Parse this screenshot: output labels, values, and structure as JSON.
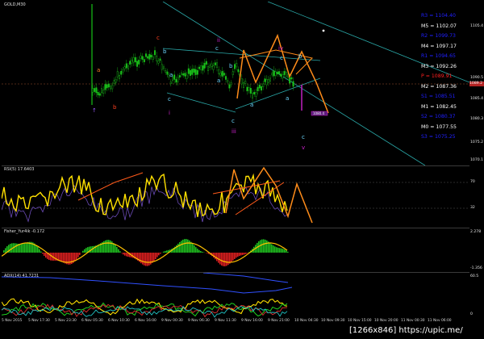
{
  "main_chart": {
    "title": "GOLD,M30",
    "price_axis": [
      "1105.4",
      "1090.5",
      "1085.4",
      "1080.3",
      "1075.2",
      "1070.1"
    ],
    "current_price_label": "1089.2",
    "pivots": [
      {
        "label": "R3 = 1104.40",
        "color": "#2020ff"
      },
      {
        "label": "M5 = 1102.07",
        "color": "#ffffff"
      },
      {
        "label": "R2 = 1099.73",
        "color": "#2020ff"
      },
      {
        "label": "M4 = 1097.17",
        "color": "#ffffff"
      },
      {
        "label": "R1 = 1094.65",
        "color": "#2020ff"
      },
      {
        "label": "M3 = 1092.26",
        "color": "#ffffff"
      },
      {
        "label": "P = 1089.91",
        "color": "#ff2020"
      },
      {
        "label": "M2 = 1087.36",
        "color": "#ffffff"
      },
      {
        "label": "S1 = 1085.51",
        "color": "#2020ff"
      },
      {
        "label": "M1 = 1082.45",
        "color": "#ffffff"
      },
      {
        "label": "S2 = 1080.37",
        "color": "#2020ff"
      },
      {
        "label": "M0 = 1077.55",
        "color": "#ffffff"
      },
      {
        "label": "S3 = 1075.25",
        "color": "#2020ff"
      }
    ],
    "target_box_label": "1080.4",
    "wave_labels": [
      "a",
      "b",
      "c",
      "iii",
      "i",
      "ii",
      "iii",
      "iv",
      "a",
      "b",
      "c",
      "a",
      "b",
      "c",
      "v",
      "a",
      "b",
      "c",
      "a",
      "b",
      "c"
    ]
  },
  "rsi_pane": {
    "title": "RSI(5) 17.6403",
    "axis": [
      "70",
      "32"
    ]
  },
  "fisher_pane": {
    "title": "Fisher_Yur4ik -0.172",
    "axis": [
      "2.278",
      "-1.356"
    ]
  },
  "adx_pane": {
    "title": "ADX(14) 41.7231",
    "axis": [
      "60.5",
      "0"
    ]
  },
  "time_axis": [
    "5 Nov 2015",
    "5 Nov 17:30",
    "5 Nov 23:30",
    "6 Nov 05:30",
    "6 Nov 10:30",
    "6 Nov 16:00",
    "9 Nov 00:30",
    "9 Nov 06:30",
    "9 Nov 11:30",
    "9 Nov 16:00",
    "9 Nov 21:00",
    "10 Nov 04:30",
    "10 Nov 09:30",
    "10 Nov 15:00",
    "10 Nov 20:00",
    "11 Nov 00:30",
    "11 Nov 06:00"
  ],
  "watermark": "[1266x846] https://upic.me/"
}
